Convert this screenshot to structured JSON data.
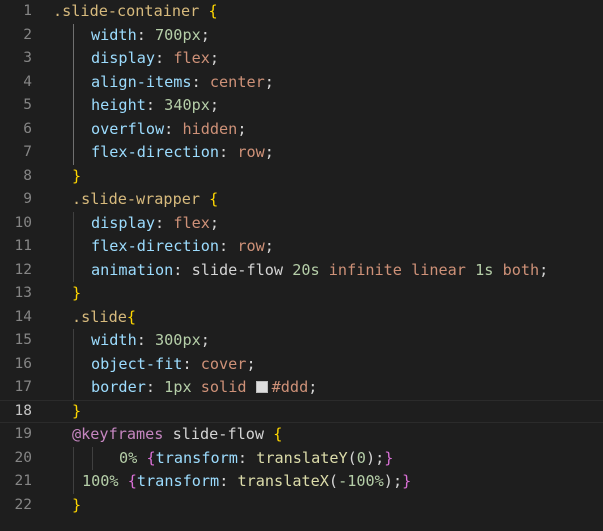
{
  "editor": {
    "language": "css",
    "active_line": "18",
    "colors": {
      "background": "#1e1e1e",
      "selector": "#d7ba7d",
      "property": "#9cdcfe",
      "value": "#ce9178",
      "number": "#b5cea8",
      "at_rule": "#c586c0",
      "function": "#dcdcaa",
      "brace": "#ffd700",
      "swatch": "#dddddd"
    },
    "lines": [
      {
        "n": "1",
        "tokens": [
          [
            ".slide-container",
            "sel"
          ],
          [
            " ",
            "plain"
          ],
          [
            "{",
            "brace"
          ]
        ]
      },
      {
        "n": "2",
        "tokens": [
          [
            "width",
            "prop"
          ],
          [
            ": ",
            "plain"
          ],
          [
            "700px",
            "num"
          ],
          [
            ";",
            "plain"
          ]
        ]
      },
      {
        "n": "3",
        "tokens": [
          [
            "display",
            "prop"
          ],
          [
            ": ",
            "plain"
          ],
          [
            "flex",
            "val"
          ],
          [
            ";",
            "plain"
          ]
        ]
      },
      {
        "n": "4",
        "tokens": [
          [
            "align-items",
            "prop"
          ],
          [
            ": ",
            "plain"
          ],
          [
            "center",
            "val"
          ],
          [
            ";",
            "plain"
          ]
        ]
      },
      {
        "n": "5",
        "tokens": [
          [
            "height",
            "prop"
          ],
          [
            ": ",
            "plain"
          ],
          [
            "340px",
            "num"
          ],
          [
            ";",
            "plain"
          ]
        ]
      },
      {
        "n": "6",
        "tokens": [
          [
            "overflow",
            "prop"
          ],
          [
            ": ",
            "plain"
          ],
          [
            "hidden",
            "val"
          ],
          [
            ";",
            "plain"
          ]
        ]
      },
      {
        "n": "7",
        "tokens": [
          [
            "flex-direction",
            "prop"
          ],
          [
            ": ",
            "plain"
          ],
          [
            "row",
            "val"
          ],
          [
            ";",
            "plain"
          ]
        ]
      },
      {
        "n": "8",
        "tokens": [
          [
            "}",
            "brace"
          ]
        ]
      },
      {
        "n": "9",
        "tokens": [
          [
            ".slide-wrapper",
            "sel"
          ],
          [
            " ",
            "plain"
          ],
          [
            "{",
            "brace"
          ]
        ]
      },
      {
        "n": "10",
        "tokens": [
          [
            "display",
            "prop"
          ],
          [
            ": ",
            "plain"
          ],
          [
            "flex",
            "val"
          ],
          [
            ";",
            "plain"
          ]
        ]
      },
      {
        "n": "11",
        "tokens": [
          [
            "flex-direction",
            "prop"
          ],
          [
            ": ",
            "plain"
          ],
          [
            "row",
            "val"
          ],
          [
            ";",
            "plain"
          ]
        ]
      },
      {
        "n": "12",
        "tokens": [
          [
            "animation",
            "prop"
          ],
          [
            ": ",
            "plain"
          ],
          [
            "slide-flow",
            "plain"
          ],
          [
            " ",
            "plain"
          ],
          [
            "20s",
            "num"
          ],
          [
            " ",
            "plain"
          ],
          [
            "infinite",
            "val"
          ],
          [
            " ",
            "plain"
          ],
          [
            "linear",
            "val"
          ],
          [
            " ",
            "plain"
          ],
          [
            "1s",
            "num"
          ],
          [
            " ",
            "plain"
          ],
          [
            "both",
            "val"
          ],
          [
            ";",
            "plain"
          ]
        ]
      },
      {
        "n": "13",
        "tokens": [
          [
            "}",
            "brace"
          ]
        ]
      },
      {
        "n": "14",
        "tokens": [
          [
            ".slide",
            "sel"
          ],
          [
            "{",
            "brace"
          ]
        ]
      },
      {
        "n": "15",
        "tokens": [
          [
            "width",
            "prop"
          ],
          [
            ": ",
            "plain"
          ],
          [
            "300px",
            "num"
          ],
          [
            ";",
            "plain"
          ]
        ]
      },
      {
        "n": "16",
        "tokens": [
          [
            "object-fit",
            "prop"
          ],
          [
            ": ",
            "plain"
          ],
          [
            "cover",
            "val"
          ],
          [
            ";",
            "plain"
          ]
        ]
      },
      {
        "n": "17",
        "tokens": [
          [
            "border",
            "prop"
          ],
          [
            ": ",
            "plain"
          ],
          [
            "1px",
            "num"
          ],
          [
            " ",
            "plain"
          ],
          [
            "solid",
            "val"
          ],
          [
            " ",
            "plain"
          ],
          [
            "#ddd",
            "val"
          ],
          [
            ";",
            "plain"
          ]
        ]
      },
      {
        "n": "18",
        "tokens": [
          [
            "}",
            "brace"
          ]
        ]
      },
      {
        "n": "19",
        "tokens": [
          [
            "@keyframes",
            "at"
          ],
          [
            " ",
            "plain"
          ],
          [
            "slide-flow",
            "plain"
          ],
          [
            " ",
            "plain"
          ],
          [
            "{",
            "brace"
          ]
        ]
      },
      {
        "n": "20",
        "tokens": [
          [
            "0%",
            "num"
          ],
          [
            " ",
            "plain"
          ],
          [
            "{",
            "brace2"
          ],
          [
            "transform",
            "prop"
          ],
          [
            ": ",
            "plain"
          ],
          [
            "translateY",
            "fn"
          ],
          [
            "(",
            "plain"
          ],
          [
            "0",
            "num"
          ],
          [
            ");",
            "plain"
          ],
          [
            "}",
            "brace2"
          ]
        ]
      },
      {
        "n": "21",
        "tokens": [
          [
            "100%",
            "num"
          ],
          [
            " ",
            "plain"
          ],
          [
            "{",
            "brace2"
          ],
          [
            "transform",
            "prop"
          ],
          [
            ": ",
            "plain"
          ],
          [
            "translateX",
            "fn"
          ],
          [
            "(",
            "plain"
          ],
          [
            "-100%",
            "num"
          ],
          [
            ");",
            "plain"
          ],
          [
            "}",
            "brace2"
          ]
        ]
      },
      {
        "n": "22",
        "tokens": [
          [
            "}",
            "brace"
          ]
        ]
      }
    ]
  }
}
